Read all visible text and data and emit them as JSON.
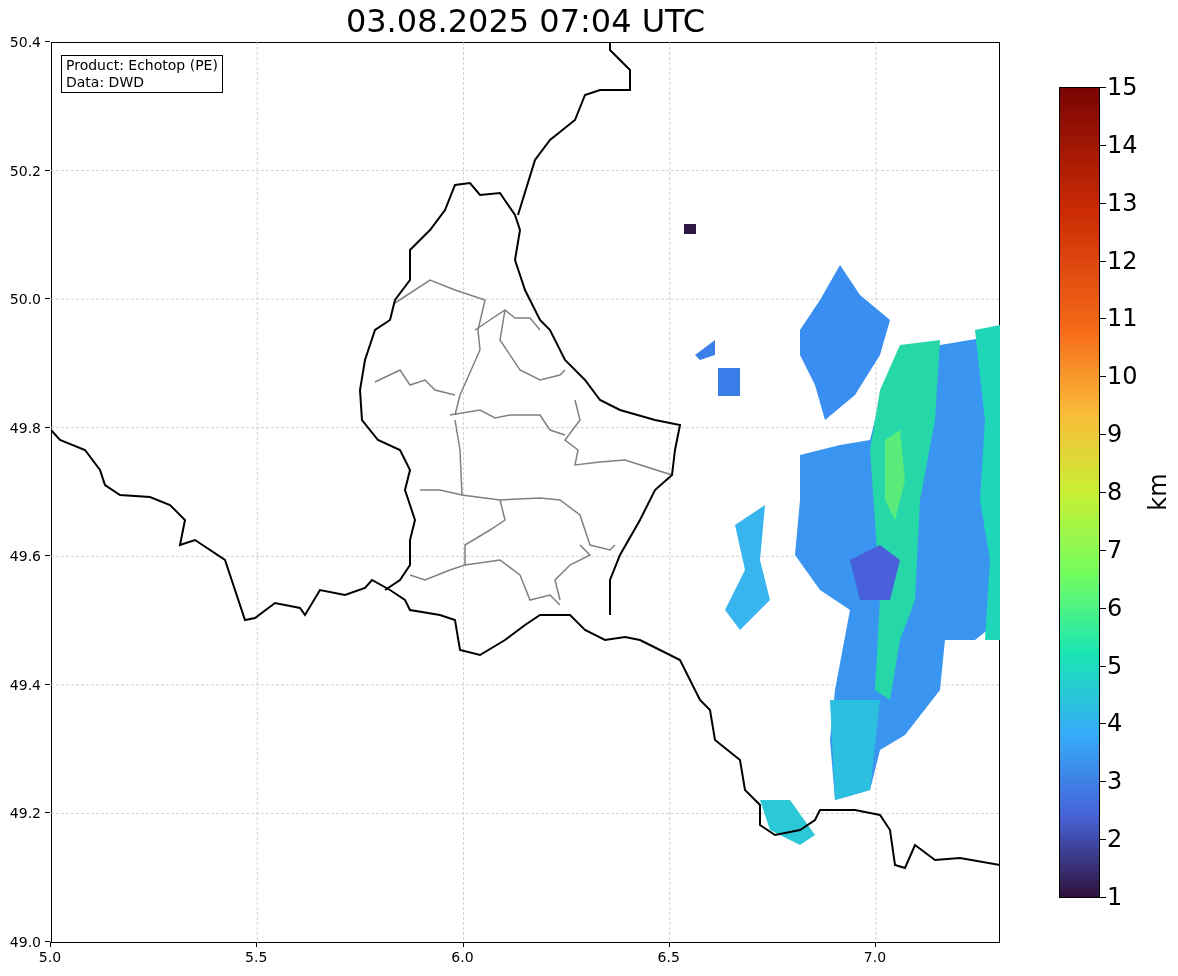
{
  "title": "03.08.2025 07:04 UTC",
  "legend": [
    "Product: Echotop (PE)",
    "Data: DWD"
  ],
  "axes": {
    "xticks": [
      "5.0",
      "5.5",
      "6.0",
      "6.5",
      "7.0"
    ],
    "yticks": [
      "50.4",
      "50.2",
      "50.0",
      "49.8",
      "49.6",
      "49.4",
      "49.2",
      "49.0"
    ]
  },
  "colorbar": {
    "label": "km",
    "ticks": [
      "15",
      "14",
      "13",
      "12",
      "11",
      "10",
      "9",
      "8",
      "7",
      "6",
      "5",
      "4",
      "3",
      "2",
      "1"
    ]
  }
}
